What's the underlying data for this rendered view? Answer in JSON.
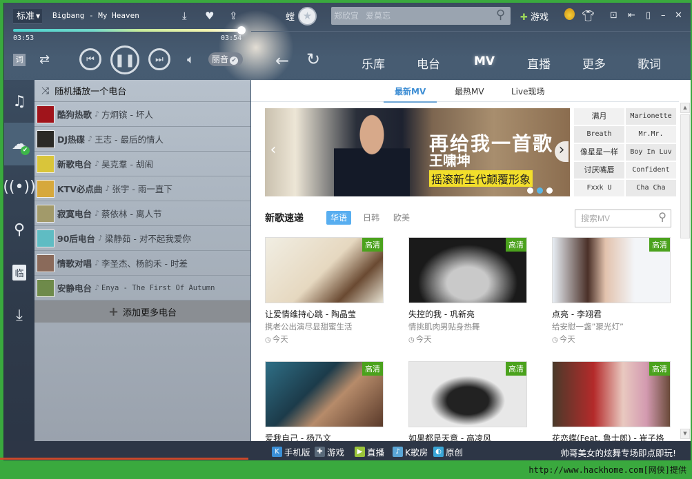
{
  "player": {
    "quality": "标准",
    "song_title": "Bigbang - My Heaven",
    "elapsed": "03:53",
    "duration": "03:54",
    "progress_fraction": 0.996,
    "lyrics_label": "词",
    "sound_effect_label": "丽音",
    "icons": [
      "download-icon",
      "heart-icon",
      "share-icon",
      "repeat-icon",
      "previous-icon",
      "pause-icon",
      "next-icon",
      "volume-icon"
    ]
  },
  "titlebar": {
    "user_char": "螳",
    "search_placeholder": "郑欣宜   爱莫忘",
    "games_label": "游戏",
    "colors": {
      "accent": "#3aa93e"
    }
  },
  "nav": {
    "tabs": [
      {
        "label": "乐库",
        "active": false
      },
      {
        "label": "电台",
        "active": false
      },
      {
        "label": "MV",
        "active": true
      },
      {
        "label": "直播",
        "active": false
      },
      {
        "label": "更多",
        "active": false
      },
      {
        "label": "歌词",
        "active": false
      }
    ]
  },
  "rail": {
    "items": [
      {
        "icon": "music-note-icon",
        "active": false
      },
      {
        "icon": "cloud-icon",
        "active": true
      },
      {
        "icon": "radio-tower-icon",
        "active": false
      },
      {
        "icon": "location-pin-icon",
        "active": false
      },
      {
        "icon": "temp-list-icon",
        "active": false
      },
      {
        "icon": "download-tray-icon",
        "active": false
      }
    ]
  },
  "radio": {
    "random_label": "随机播放一个电台",
    "stations": [
      {
        "name": "酷狗热歌",
        "song": "方炯镔 - 坏人",
        "thumb": "#a0141b"
      },
      {
        "name": "DJ热碟",
        "song": "王志 - 最后的情人",
        "thumb": "#2b2a26"
      },
      {
        "name": "新歌电台",
        "song": "吴克羣 - 胡闹",
        "thumb": "#d9c53a"
      },
      {
        "name": "KTV必点曲",
        "song": "张宇 - 雨一直下",
        "thumb": "#d6a83c"
      },
      {
        "name": "寂寞电台",
        "song": "蔡依林 - 离人节",
        "thumb": "#a29a6a"
      },
      {
        "name": "90后电台",
        "song": "梁静茹 - 对不起我爱你",
        "thumb": "#5fbcc3"
      },
      {
        "name": "情歌对唱",
        "song": "李圣杰、杨韵禾 - 时差",
        "thumb": "#8a6a5a"
      },
      {
        "name": "安静电台",
        "song": "Enya - The First Of Autumn",
        "thumb": "#6e8a4a",
        "mono": true
      }
    ],
    "add_label": "添加更多电台"
  },
  "content": {
    "subtabs": [
      {
        "label": "最新MV",
        "active": true
      },
      {
        "label": "最热MV",
        "active": false
      },
      {
        "label": "Live现场",
        "active": false
      }
    ],
    "banner": {
      "title": "再给我一首歌",
      "artist": "王啸坤",
      "subtitle": "摇滚新生代颠覆形象",
      "slide_count": 3,
      "active_slide": 2
    },
    "quick_links": [
      "满月",
      "Marionette",
      "Breath",
      "Mr.Mr.",
      "像星星一样",
      "Boy In Luv",
      "讨厌嘴唇",
      "Confident",
      "Fxxk U",
      "Cha Cha"
    ],
    "section_title": "新歌速递",
    "regions": [
      {
        "label": "华语",
        "active": true
      },
      {
        "label": "日韩",
        "active": false
      },
      {
        "label": "欧美",
        "active": false
      }
    ],
    "search_placeholder": "搜索MV",
    "hd_label": "高清",
    "mvs": [
      {
        "title": "让爱情维持心跳 - 陶晶莹",
        "desc": "携老公出演尽显甜蜜生活",
        "date": "今天",
        "thumb": "linear-gradient(135deg,#f1eee3,#e6d8c0 50%,#6a4a32 75%,#e7e2d2)"
      },
      {
        "title": "失控的我 - 巩新亮",
        "desc": "情挑肌肉男贴身热舞",
        "date": "今天",
        "thumb": "radial-gradient(ellipse at 50% 70%,#c9c9c9 0 25%,#1a1a1a 60%)"
      },
      {
        "title": "点亮 - 李翊君",
        "desc": "给安慰一盏”聚光灯”",
        "date": "今天",
        "thumb": "linear-gradient(90deg,#e8eef4,#4a3028 30%,#e2c2ad 45%,#f3f5f8 70%)"
      },
      {
        "title": "爱我自己 - 杨乃文",
        "desc": "",
        "date": "",
        "thumb": "linear-gradient(135deg,#2f6f86,#1c3b4a 40%,#b68b6a 60%,#5a3a2a)"
      },
      {
        "title": "如果都是天意 - 高凌风",
        "desc": "",
        "date": "",
        "thumb": "radial-gradient(ellipse at 50% 60%,#222 0 25%,#e8e8e8 45%)"
      },
      {
        "title": "花恋蝶(Feat. 鲁士郎) - 崔子格",
        "desc": "",
        "date": "",
        "thumb": "linear-gradient(90deg,#4a3a2a,#b42a2a 35%,#e9c9c0 60%,#d39ab0 80%,#6a4a3a)"
      }
    ]
  },
  "bottombar": {
    "links": [
      {
        "label": "手机版",
        "icon": "kugou-mobile-icon",
        "color": "#3a8fd6",
        "glyph": "K"
      },
      {
        "label": "游戏",
        "icon": "gamepad-icon",
        "color": "#5a6a7a",
        "glyph": "✚"
      },
      {
        "label": "直播",
        "icon": "live-icon",
        "color": "#9ac43a",
        "glyph": "▶"
      },
      {
        "label": "K歌房",
        "icon": "microphone-icon",
        "color": "#5aa6d6",
        "glyph": "♪"
      },
      {
        "label": "原创",
        "icon": "original-icon",
        "color": "#3aa6d6",
        "glyph": "◐"
      }
    ],
    "promo": "帅哥美女的炫舞专场即点即玩!"
  },
  "watermark": "http://www.hackhome.com[网侠]提供"
}
